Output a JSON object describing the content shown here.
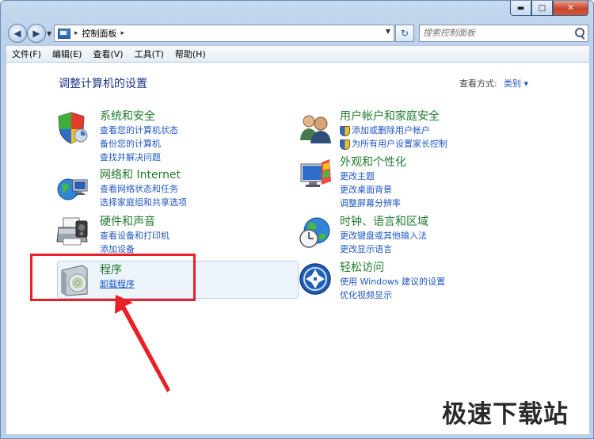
{
  "titlebar": {
    "min": "▬",
    "max": "□",
    "close": "✕"
  },
  "address": {
    "segment": "控制面板",
    "arrow": "▸"
  },
  "search": {
    "placeholder": "搜索控制面板"
  },
  "menu": [
    "文件(F)",
    "编辑(E)",
    "查看(V)",
    "工具(T)",
    "帮助(H)"
  ],
  "main": {
    "heading": "调整计算机的设置",
    "view_by_label": "查看方式:",
    "view_by_value": "类别 ▾"
  },
  "categories": [
    {
      "title": "系统和安全",
      "links": [
        "查看您的计算机状态",
        "备份您的计算机",
        "查找并解决问题"
      ],
      "icon": "shield-icon"
    },
    {
      "title": "网络和 Internet",
      "links": [
        "查看网络状态和任务",
        "选择家庭组和共享选项"
      ],
      "icon": "network-icon"
    },
    {
      "title": "硬件和声音",
      "links": [
        "查看设备和打印机",
        "添加设备"
      ],
      "icon": "printer-icon"
    },
    {
      "title": "程序",
      "links": [
        "卸载程序"
      ],
      "icon": "programs-icon"
    },
    {
      "title": "用户帐户和家庭安全",
      "links": [
        "添加或删除用户帐户",
        "为所有用户设置家长控制"
      ],
      "icon": "users-icon"
    },
    {
      "title": "外观和个性化",
      "links": [
        "更改主题",
        "更改桌面背景",
        "调整屏幕分辨率"
      ],
      "icon": "appearance-icon"
    },
    {
      "title": "时钟、语言和区域",
      "links": [
        "更改键盘或其他输入法",
        "更改显示语言"
      ],
      "icon": "clock-globe-icon"
    },
    {
      "title": "轻松访问",
      "links": [
        "使用 Windows 建议的设置",
        "优化视频显示"
      ],
      "icon": "ease-of-access-icon"
    }
  ],
  "watermark": "极速下载站",
  "colors": {
    "title_green": "#1f7a2e",
    "link_blue": "#1e56c4",
    "heading_blue": "#1e3287",
    "annotation_red": "#ea2028"
  }
}
